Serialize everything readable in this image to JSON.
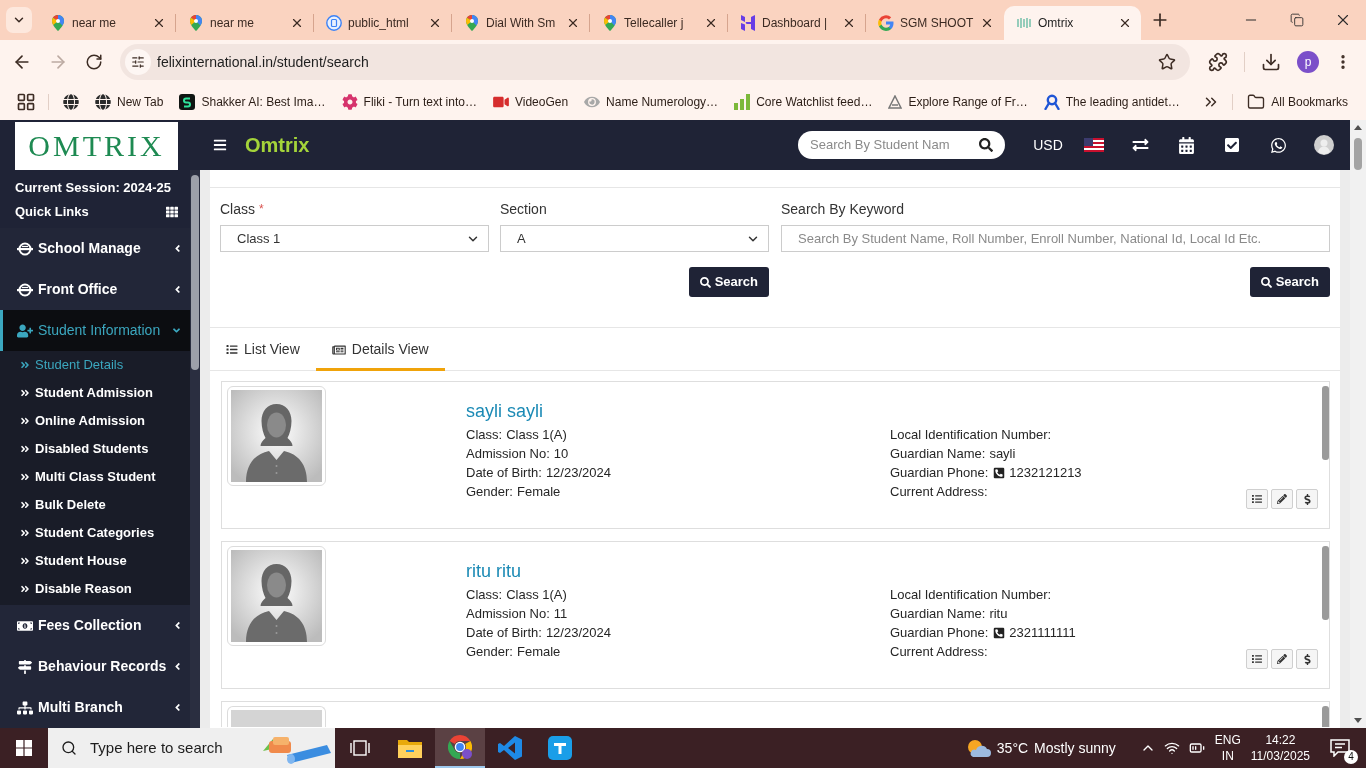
{
  "browser": {
    "tabs": [
      {
        "title": "near me",
        "kind": "maps",
        "selected": false
      },
      {
        "title": "near me",
        "kind": "maps",
        "selected": false
      },
      {
        "title": "public_html",
        "kind": "file",
        "selected": false
      },
      {
        "title": "Dial With Sm",
        "kind": "maps",
        "selected": false
      },
      {
        "title": "Tellecaller j",
        "kind": "maps",
        "selected": false
      },
      {
        "title": "Dashboard |",
        "kind": "hostinger",
        "selected": false
      },
      {
        "title": "SGM SHOOT",
        "kind": "google",
        "selected": false
      },
      {
        "title": "Omtrix",
        "kind": "omtrix",
        "selected": true
      }
    ],
    "forward_disabled": true,
    "address": "felixinternational.in/student/search",
    "profile_initial": "p",
    "bookmarks": [
      {
        "kind": "globe"
      },
      {
        "label": "New Tab",
        "kind": "globe"
      },
      {
        "label": "Shakker AI: Best Ima…",
        "kind": "shakker"
      },
      {
        "label": "Fliki - Turn text into…",
        "kind": "fliki"
      },
      {
        "label": "VideoGen",
        "kind": "video"
      },
      {
        "label": "Name Numerology…",
        "kind": "eye"
      },
      {
        "label": "Core Watchlist feed…",
        "kind": "bars"
      },
      {
        "label": "Explore Range of Fr…",
        "kind": "triangle"
      },
      {
        "label": "The leading antidet…",
        "kind": "ribbon"
      }
    ],
    "all_bookmarks": "All Bookmarks"
  },
  "header": {
    "logo": "OMTRIX",
    "brand": "Omtrix",
    "search": {
      "placeholder": "Search By Student Nam"
    },
    "currency": "USD"
  },
  "sidebar": {
    "session": "Current Session: 2024-25",
    "quick_links": "Quick Links",
    "items": [
      {
        "label": "School Manage",
        "kind": "server",
        "expanded": false,
        "selected": false
      },
      {
        "label": "Front Office",
        "kind": "server",
        "expanded": false,
        "selected": false
      },
      {
        "label": "Student Information",
        "kind": "user-plus",
        "expanded": true,
        "selected": true,
        "children": [
          {
            "label": "Student Details",
            "selected": true
          },
          {
            "label": "Student Admission",
            "selected": false
          },
          {
            "label": "Online Admission",
            "selected": false
          },
          {
            "label": "Disabled Students",
            "selected": false
          },
          {
            "label": "Multi Class Student",
            "selected": false
          },
          {
            "label": "Bulk Delete",
            "selected": false
          },
          {
            "label": "Student Categories",
            "selected": false
          },
          {
            "label": "Student House",
            "selected": false
          },
          {
            "label": "Disable Reason",
            "selected": false
          }
        ]
      },
      {
        "label": "Fees Collection",
        "kind": "money",
        "expanded": false,
        "selected": false
      },
      {
        "label": "Behaviour Records",
        "kind": "signs",
        "expanded": false,
        "selected": false
      },
      {
        "label": "Multi Branch",
        "kind": "sitemap",
        "expanded": false,
        "selected": false
      }
    ]
  },
  "criteria": {
    "fields": [
      {
        "label": "Class",
        "marker": "*",
        "kind": "select",
        "value": "Class 1"
      },
      {
        "label": "Section",
        "kind": "select",
        "value": "A",
        "button": "Search"
      },
      {
        "label": "Search By Keyword",
        "kind": "text",
        "placeholder": "Search By Student Name, Roll Number, Enroll Number, National Id, Local Id Etc.",
        "button": "Search"
      }
    ]
  },
  "view_tabs": [
    {
      "label": "List View",
      "kind": "list",
      "selected": false
    },
    {
      "label": "Details View",
      "kind": "details",
      "selected": true
    }
  ],
  "students": [
    {
      "kind": "full",
      "name": "sayli sayli",
      "left": [
        {
          "label": "Class:",
          "value": "Class 1(A)",
          "kind": "text"
        },
        {
          "label": "Admission No:",
          "value": "10",
          "kind": "text"
        },
        {
          "label": "Date of Birth:",
          "value": "12/23/2024",
          "kind": "text"
        },
        {
          "label": "Gender:",
          "value": "Female",
          "kind": "text"
        }
      ],
      "right": [
        {
          "label": "Local Identification Number:",
          "kind": "text"
        },
        {
          "label": "Guardian Name:",
          "value": "sayli",
          "kind": "text"
        },
        {
          "label": "Guardian Phone:",
          "value": "1232121213",
          "kind": "phone"
        },
        {
          "label": "Current Address:",
          "kind": "text"
        }
      ]
    },
    {
      "kind": "full",
      "name": "ritu ritu",
      "left": [
        {
          "label": "Class:",
          "value": "Class 1(A)",
          "kind": "text"
        },
        {
          "label": "Admission No:",
          "value": "11",
          "kind": "text"
        },
        {
          "label": "Date of Birth:",
          "value": "12/23/2024",
          "kind": "text"
        },
        {
          "label": "Gender:",
          "value": "Female",
          "kind": "text"
        }
      ],
      "right": [
        {
          "label": "Local Identification Number:",
          "kind": "text"
        },
        {
          "label": "Guardian Name:",
          "value": "ritu",
          "kind": "text"
        },
        {
          "label": "Guardian Phone:",
          "value": "2321111111",
          "kind": "phone"
        },
        {
          "label": "Current Address:",
          "kind": "text"
        }
      ]
    },
    {
      "kind": "cut"
    }
  ],
  "taskbar": {
    "search": {
      "placeholder": "Type here to search"
    },
    "apps": [
      {
        "kind": "task-view",
        "selected": false
      },
      {
        "kind": "explorer",
        "selected": false
      },
      {
        "kind": "chrome",
        "selected": true
      },
      {
        "kind": "vscode",
        "selected": false
      },
      {
        "kind": "todo",
        "selected": false
      }
    ],
    "weather": {
      "temp": "35°C",
      "text": "Mostly sunny"
    },
    "language": [
      "ENG",
      "IN"
    ],
    "time": "14:22",
    "date": "11/03/2025",
    "notifications": "4"
  }
}
